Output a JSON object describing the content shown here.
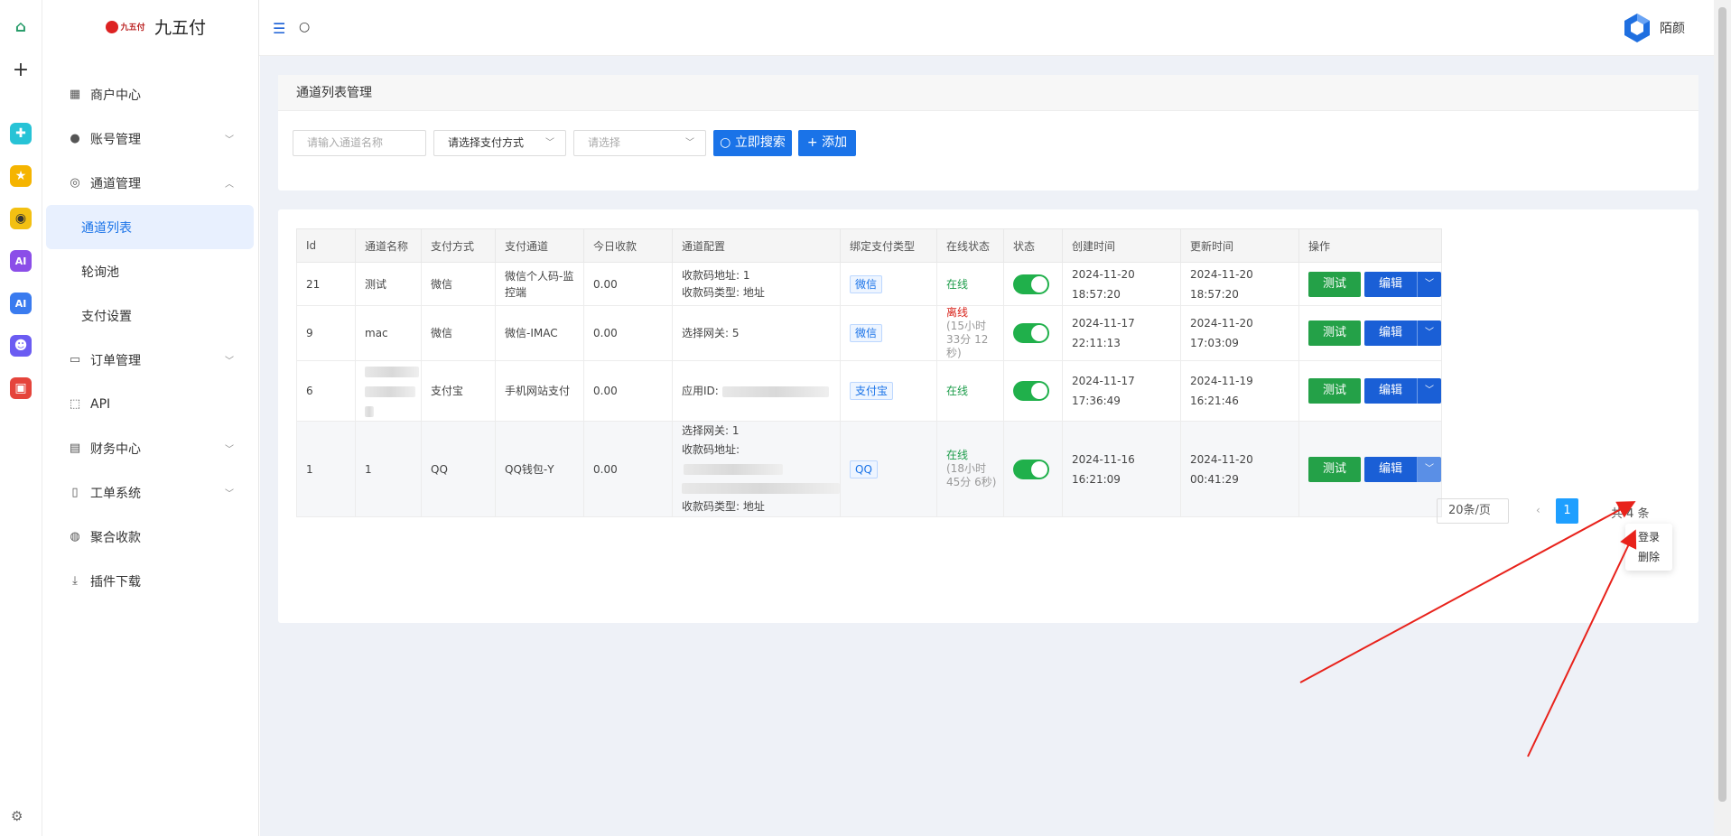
{
  "brand": {
    "logo_text": "九五付",
    "app_name": "九五付"
  },
  "sidebar": {
    "items": [
      {
        "label": "商户中心",
        "icon": "dashboard-icon",
        "expandable": false
      },
      {
        "label": "账号管理",
        "icon": "user-icon",
        "expandable": true
      },
      {
        "label": "通道管理",
        "icon": "channel-icon",
        "expandable": true,
        "expanded": true
      },
      {
        "label": "通道列表",
        "sub": true,
        "active": true
      },
      {
        "label": "轮询池",
        "sub": true
      },
      {
        "label": "支付设置",
        "sub": true
      },
      {
        "label": "订单管理",
        "icon": "order-icon",
        "expandable": true
      },
      {
        "label": "API",
        "icon": "chip-icon",
        "expandable": false
      },
      {
        "label": "财务中心",
        "icon": "finance-icon",
        "expandable": true
      },
      {
        "label": "工单系统",
        "icon": "book-icon",
        "expandable": true
      },
      {
        "label": "聚合收款",
        "icon": "collect-icon",
        "expandable": false
      },
      {
        "label": "插件下载",
        "icon": "download-icon",
        "expandable": false
      }
    ]
  },
  "topbar": {
    "user_name": "陌颜"
  },
  "panel": {
    "title": "通道列表管理",
    "name_placeholder": "请输入通道名称",
    "pay_method_placeholder": "请选择支付方式",
    "select_placeholder": "请选择",
    "search_label": "立即搜索",
    "add_label": "添加"
  },
  "table": {
    "headers": [
      "Id",
      "通道名称",
      "支付方式",
      "支付通道",
      "今日收款",
      "通道配置",
      "绑定支付类型",
      "在线状态",
      "状态",
      "创建时间",
      "更新时间",
      "操作"
    ],
    "rows": [
      {
        "id": "21",
        "name": "测试",
        "method": "微信",
        "channel": "微信个人码-监控端",
        "today": "0.00",
        "config": [
          "收款码地址: 1",
          "收款码类型: 地址"
        ],
        "bind": "微信",
        "online": "在线",
        "online_detail": "",
        "created": "2024-11-20 18:57:20",
        "updated": "2024-11-20 18:57:20"
      },
      {
        "id": "9",
        "name": "mac",
        "method": "微信",
        "channel": "微信-IMAC",
        "today": "0.00",
        "config": [
          "选择网关: 5"
        ],
        "bind": "微信",
        "online": "离线",
        "online_detail": "(15小时 33分 12秒)",
        "created": "2024-11-17 22:11:13",
        "updated": "2024-11-20 17:03:09"
      },
      {
        "id": "6",
        "name": "",
        "method": "支付宝",
        "channel": "手机网站支付",
        "today": "0.00",
        "config": [
          "应用ID:"
        ],
        "bind": "支付宝",
        "online": "在线",
        "online_detail": "",
        "created": "2024-11-17 17:36:49",
        "updated": "2024-11-19 16:21:46"
      },
      {
        "id": "1",
        "name": "1",
        "method": "QQ",
        "channel": "QQ钱包-Y",
        "today": "0.00",
        "config": [
          "选择网关: 1",
          "收款码地址:",
          "",
          "收款码类型: 地址"
        ],
        "bind": "QQ",
        "online": "在线",
        "online_detail": "(18小时 45分 6秒)",
        "created": "2024-11-16 16:21:09",
        "updated": "2024-11-20 00:41:29"
      }
    ],
    "btn_test": "测试",
    "btn_edit": "编辑"
  },
  "dropdown": {
    "items": [
      "登录",
      "删除"
    ]
  },
  "pagination": {
    "page_size": "20条/页",
    "current": "1",
    "total": "共 4 条"
  },
  "colors": {
    "primary": "#1a73e8",
    "success": "#24a148",
    "danger": "#d9241c"
  }
}
